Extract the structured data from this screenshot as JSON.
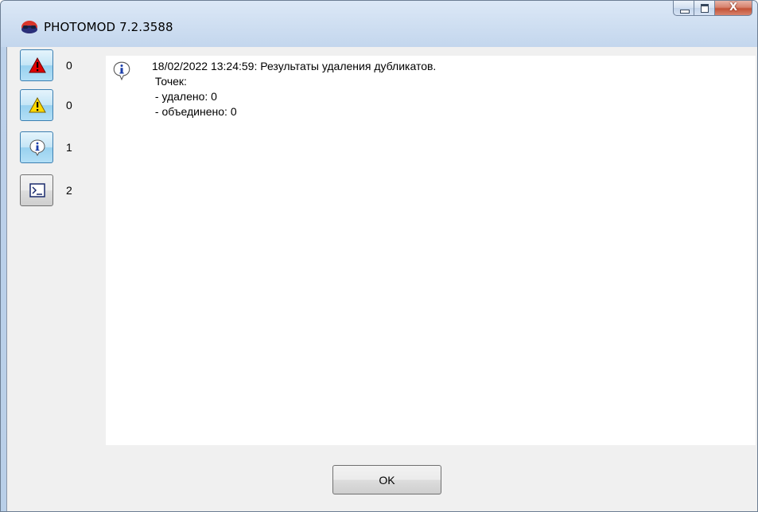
{
  "window": {
    "title": "PHOTOMOD 7.2.3588",
    "app_icon": "photomod-logo-icon",
    "caption_buttons": {
      "minimize_icon": "minimize-icon",
      "maximize_icon": "maximize-icon",
      "close_label": "X"
    }
  },
  "filters": [
    {
      "icon": "error-icon",
      "count": "0",
      "pressed": true
    },
    {
      "icon": "warning-icon",
      "count": "0",
      "pressed": true
    },
    {
      "icon": "info-icon",
      "count": "1",
      "pressed": true
    },
    {
      "icon": "console-icon",
      "count": "2",
      "pressed": false
    }
  ],
  "log": {
    "entry_icon": "info-icon",
    "lines": [
      "18/02/2022 13:24:59: Результаты удаления дубликатов.",
      " Точек:",
      " - удалено: 0",
      " - объединено: 0"
    ]
  },
  "ok_button": {
    "label": "OK"
  },
  "colors": {
    "error": "#e00000",
    "warning": "#ffd800",
    "pressed_button": "#b3dff6"
  }
}
